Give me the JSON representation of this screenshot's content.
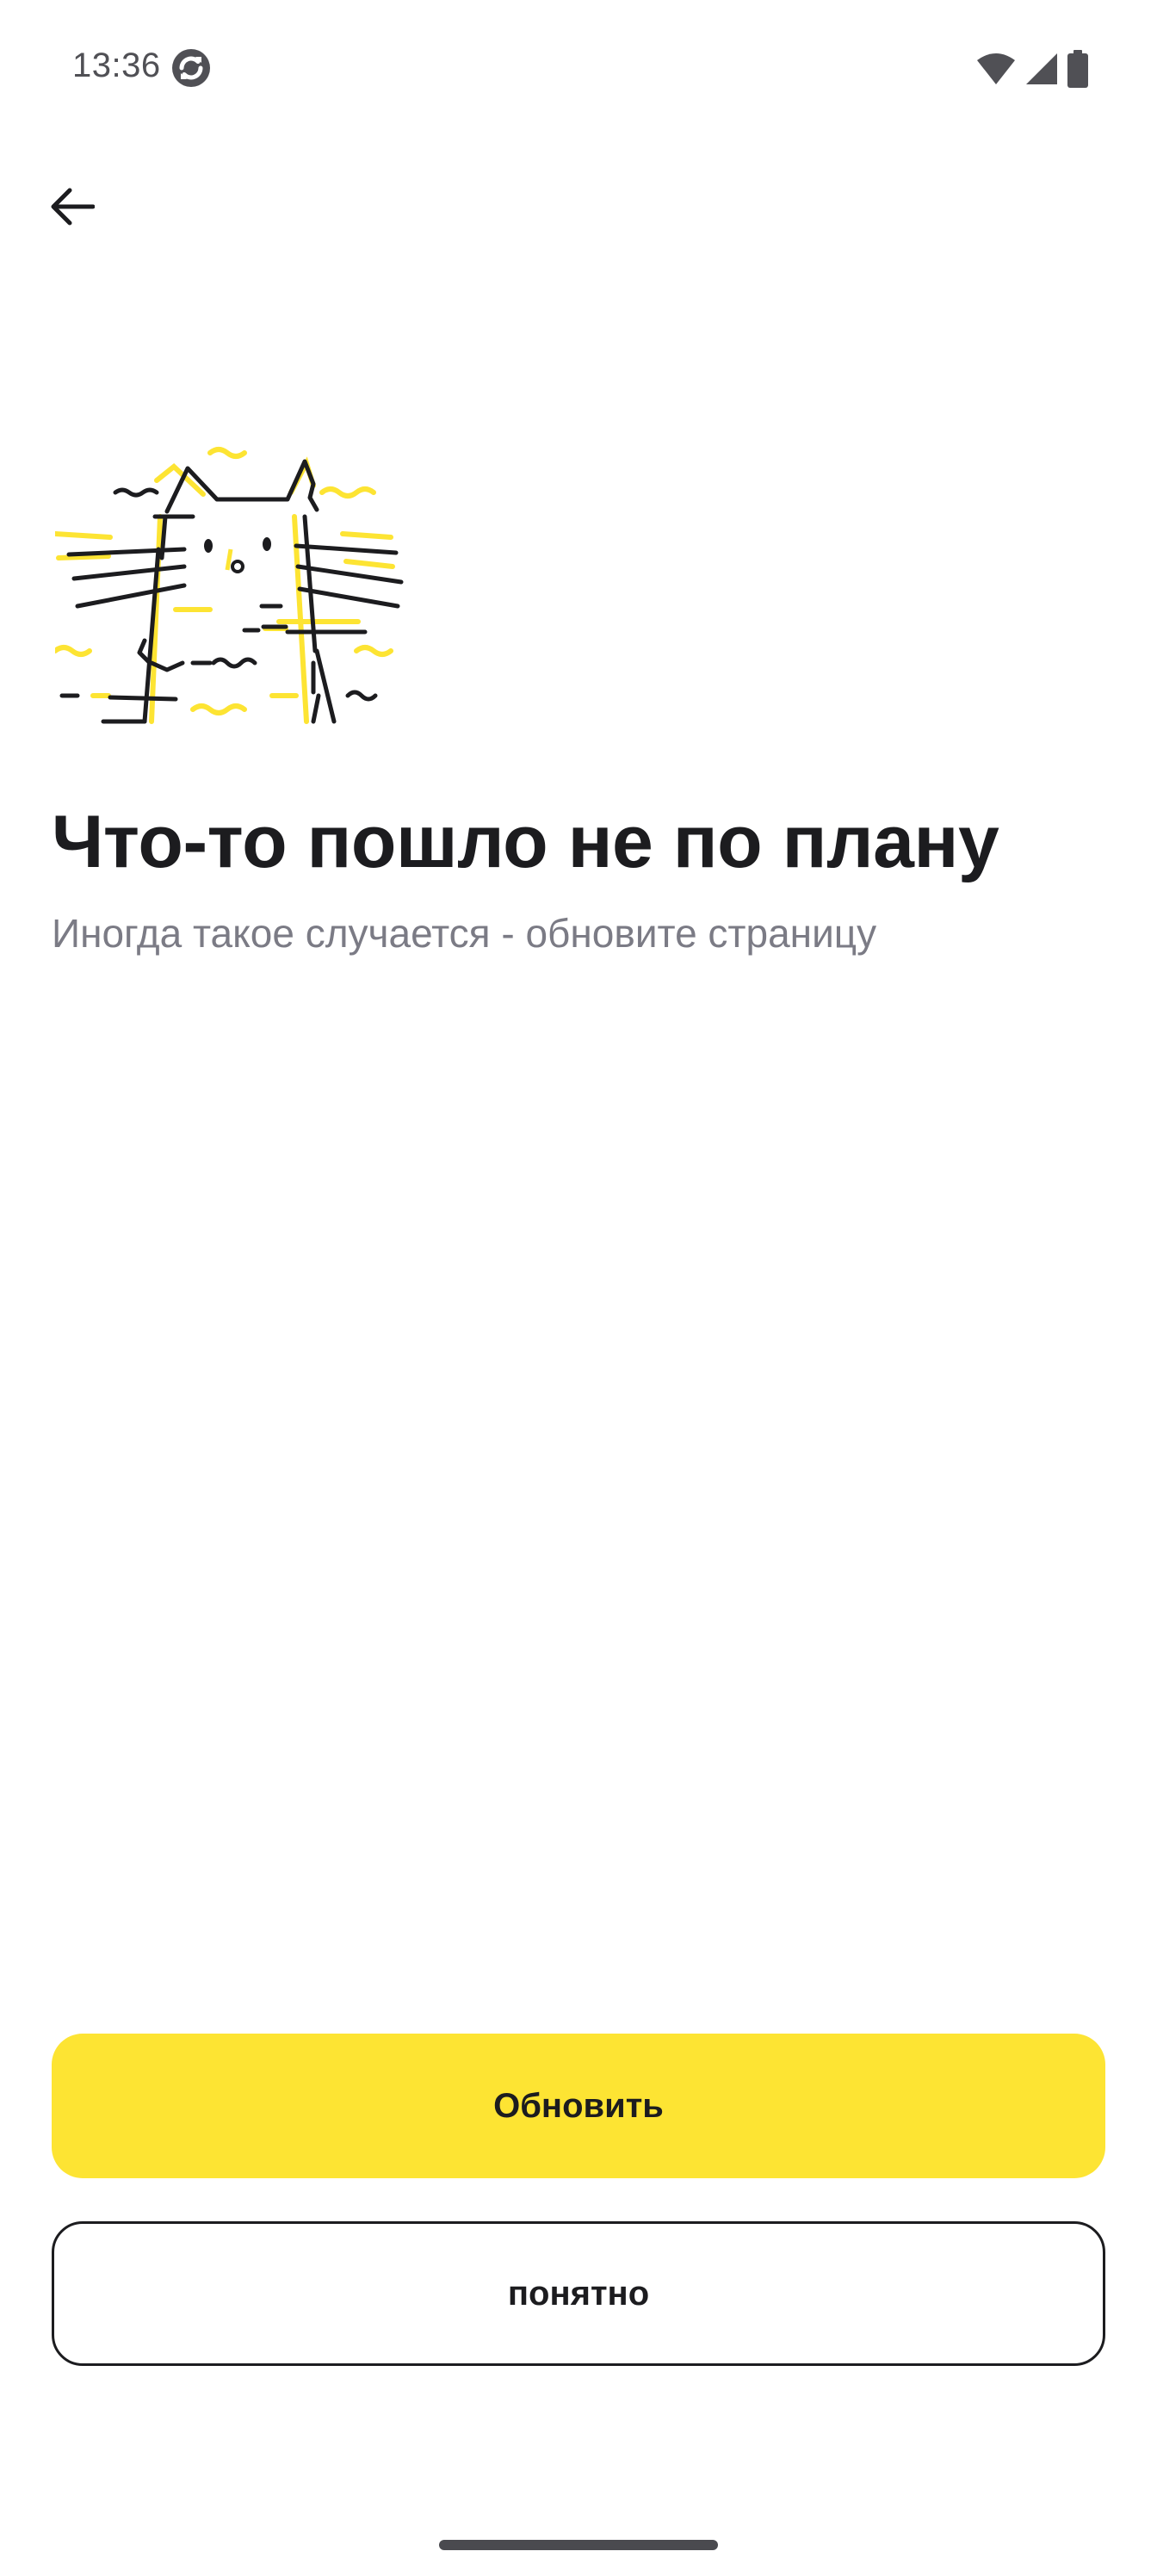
{
  "status_bar": {
    "time": "13:36",
    "app_icon": "sync-icon",
    "icons": [
      "wifi-icon",
      "cell-signal-icon",
      "battery-icon"
    ]
  },
  "app_bar": {
    "back_icon": "arrow-left-icon"
  },
  "illustration": {
    "icon": "glitched-cat-icon",
    "colors": {
      "line": "#1c1c1f",
      "accent": "#fde433"
    }
  },
  "error": {
    "title": "Что-то пошло не по плану",
    "subtitle": "Иногда такое случается - обновите страницу"
  },
  "actions": {
    "refresh_label": "Обновить",
    "dismiss_label": "понятно"
  },
  "colors": {
    "primary_button": "#fde433",
    "text": "#1c1c1f",
    "secondary_text": "#7b7b85",
    "background": "#ffffff"
  }
}
